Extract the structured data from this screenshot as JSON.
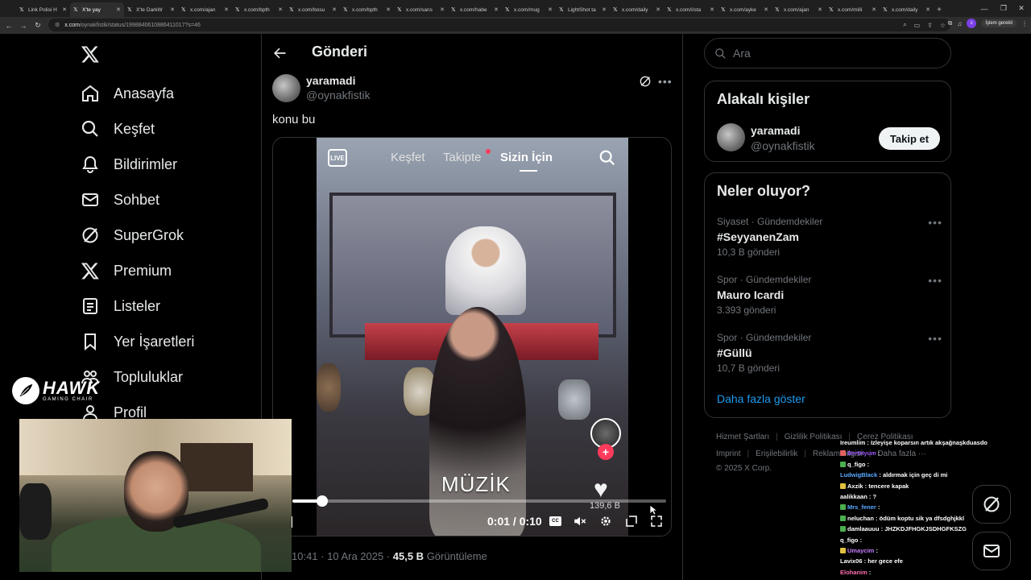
{
  "browser": {
    "tabs": [
      {
        "label": "Link Polisi H",
        "active": false
      },
      {
        "label": "X'te yay",
        "active": true
      },
      {
        "label": "X'te DarkW",
        "active": false
      },
      {
        "label": "x.com/ajan",
        "active": false
      },
      {
        "label": "x.com/bpth",
        "active": false
      },
      {
        "label": "x.com/bosu",
        "active": false
      },
      {
        "label": "x.com/bpth",
        "active": false
      },
      {
        "label": "x.com/sans",
        "active": false
      },
      {
        "label": "x.com/habe",
        "active": false
      },
      {
        "label": "x.com/mug",
        "active": false
      },
      {
        "label": "LightShot ta",
        "active": false
      },
      {
        "label": "x.com/daily",
        "active": false
      },
      {
        "label": "x.com/i/sta",
        "active": false
      },
      {
        "label": "x.com/ayke",
        "active": false
      },
      {
        "label": "x.com/ajan",
        "active": false
      },
      {
        "label": "x.com/milli",
        "active": false
      },
      {
        "label": "x.com/daily",
        "active": false
      }
    ],
    "url_host": "x.com",
    "url_path": "/oynakfistik/status/1998840610886411017?s=46",
    "action_pill": "İşlem gerekli",
    "profile_initial": "c"
  },
  "nav": {
    "items": [
      {
        "label": "Anasayfa",
        "icon": "home-icon"
      },
      {
        "label": "Keşfet",
        "icon": "search-icon"
      },
      {
        "label": "Bildirimler",
        "icon": "bell-icon"
      },
      {
        "label": "Sohbet",
        "icon": "mail-icon"
      },
      {
        "label": "SuperGrok",
        "icon": "grok-icon"
      },
      {
        "label": "Premium",
        "icon": "x-icon"
      },
      {
        "label": "Listeler",
        "icon": "list-icon"
      },
      {
        "label": "Yer İşaretleri",
        "icon": "bookmark-icon"
      },
      {
        "label": "Topluluklar",
        "icon": "people-icon"
      },
      {
        "label": "Profil",
        "icon": "user-icon"
      }
    ]
  },
  "header": {
    "title": "Gönderi"
  },
  "post": {
    "name": "yaramadi",
    "handle": "@oynakfistik",
    "text": "konu bu",
    "time": "10:41 · 10 Ara 2025 · ",
    "views_count": "45,5 B",
    "views_label": " Görüntüleme",
    "video": {
      "tabs": [
        "Keşfet",
        "Takipte",
        "Sizin İçin"
      ],
      "active_tab": "Sizin İçin",
      "live_label": "LIVE",
      "caption": "MÜZİK",
      "likes": "139,6 B",
      "time_display": "0:01 / 0:10",
      "cc_label": "CC",
      "progress": 0.08
    }
  },
  "sidebar": {
    "search_placeholder": "Ara",
    "related_title": "Alakalı kişiler",
    "related": {
      "name": "yaramadi",
      "handle": "@oynakfistik",
      "follow_label": "Takip et"
    },
    "trends_title": "Neler oluyor?",
    "trends": [
      {
        "context": "Siyaset · Gündemdekiler",
        "name": "#SeyyanenZam",
        "count": "10,3 B gönderi"
      },
      {
        "context": "Spor · Gündemdekiler",
        "name": "Mauro Icardi",
        "count": "3.393 gönderi"
      },
      {
        "context": "Spor · Gündemdekiler",
        "name": "#Güllü",
        "count": "10,7 B gönderi"
      }
    ],
    "show_more": "Daha fazla göster",
    "footer": {
      "line1": [
        "Hizmet Şartları",
        "Gizlilik Politikası",
        "Çerez Politikası"
      ],
      "line2": [
        "Imprint",
        "Erişilebilirlik",
        "Reklam bilgisi",
        "Daha fazla ···"
      ],
      "copyright": "© 2025 X Corp."
    }
  },
  "overlay": {
    "sponsor": {
      "brand": "HAWK",
      "tagline": "GAMING CHAIR"
    },
    "chat": [
      {
        "user": "Ireumlim",
        "msg": "Izleyişe koparsın artık akşağnaşkduasdo",
        "color": "#ffffff",
        "badge": ""
      },
      {
        "user": "BertHyum",
        "msg": "",
        "color": "#9b59ff",
        "badge": "#e06060"
      },
      {
        "user": "q_figo",
        "msg": "",
        "color": "#ffffff",
        "badge": "#4caf50"
      },
      {
        "user": "LudwigBlack",
        "msg": "aldırmak için geç di mi",
        "color": "#5aa9ff",
        "badge": ""
      },
      {
        "user": "Axzik",
        "msg": "tencere kapak",
        "color": "#ffffff",
        "badge": "#e0c040"
      },
      {
        "user": "aalikkaan",
        "msg": "?",
        "color": "#ffffff",
        "badge": ""
      },
      {
        "user": "Mrs_fener",
        "msg": "",
        "color": "#5aa9ff",
        "badge": "#4caf50"
      },
      {
        "user": "neluchan",
        "msg": "ödüm koptu sik ya dfsdghjkkl",
        "color": "#ffffff",
        "badge": "#4caf50"
      },
      {
        "user": "damlaauuu",
        "msg": "JHZKDJFHGKJSDHGFKSZG",
        "color": "#ffffff",
        "badge": "#4caf50"
      },
      {
        "user": "q_figo",
        "msg": "",
        "color": "#ffffff",
        "badge": ""
      },
      {
        "user": "Umaycim",
        "msg": "",
        "color": "#c77dff",
        "badge": "#e0c040"
      },
      {
        "user": "Lavix06",
        "msg": "her gece efe",
        "color": "#ffffff",
        "badge": ""
      },
      {
        "user": "Elohanim",
        "msg": "",
        "color": "#ff6fb0",
        "badge": ""
      }
    ]
  }
}
